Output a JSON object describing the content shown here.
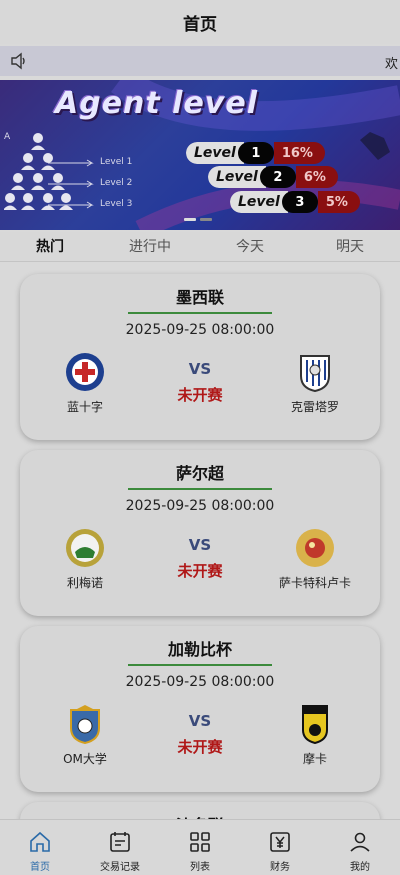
{
  "header": {
    "title": "首页"
  },
  "notice": {
    "tail_text": "欢"
  },
  "banner": {
    "title": "Agent level",
    "pyramid_labels": [
      "Level 1",
      "Level 2",
      "Level 3"
    ],
    "apex_label": "A",
    "levels": [
      {
        "label": "Level",
        "num": "1",
        "pct": "16%"
      },
      {
        "label": "Level",
        "num": "2",
        "pct": "6%"
      },
      {
        "label": "Level",
        "num": "3",
        "pct": "5%"
      }
    ]
  },
  "tabs": [
    {
      "label": "热门"
    },
    {
      "label": "进行中"
    },
    {
      "label": "今天"
    },
    {
      "label": "明天"
    }
  ],
  "matches": [
    {
      "league": "墨西联",
      "time": "2025-09-25 08:00:00",
      "home": "蓝十字",
      "away": "克雷塔罗",
      "vs": "VS",
      "status": "未开赛"
    },
    {
      "league": "萨尔超",
      "time": "2025-09-25 08:00:00",
      "home": "利梅诺",
      "away": "萨卡特科卢卡",
      "vs": "VS",
      "status": "未开赛"
    },
    {
      "league": "加勒比杯",
      "time": "2025-09-25 08:00:00",
      "home": "OM大学",
      "away": "摩卡",
      "vs": "VS",
      "status": "未开赛"
    },
    {
      "league": "沙名联"
    }
  ],
  "bottom_nav": [
    {
      "label": "首页",
      "icon": "home-icon"
    },
    {
      "label": "交易记录",
      "icon": "records-icon"
    },
    {
      "label": "列表",
      "icon": "grid-icon"
    },
    {
      "label": "财务",
      "icon": "finance-icon"
    },
    {
      "label": "我的",
      "icon": "user-icon"
    }
  ],
  "colors": {
    "status_red": "#b01818",
    "vs_blue": "#3a4a7a",
    "divider_green": "#3c8a3c",
    "active_nav": "#2a6aa8"
  }
}
